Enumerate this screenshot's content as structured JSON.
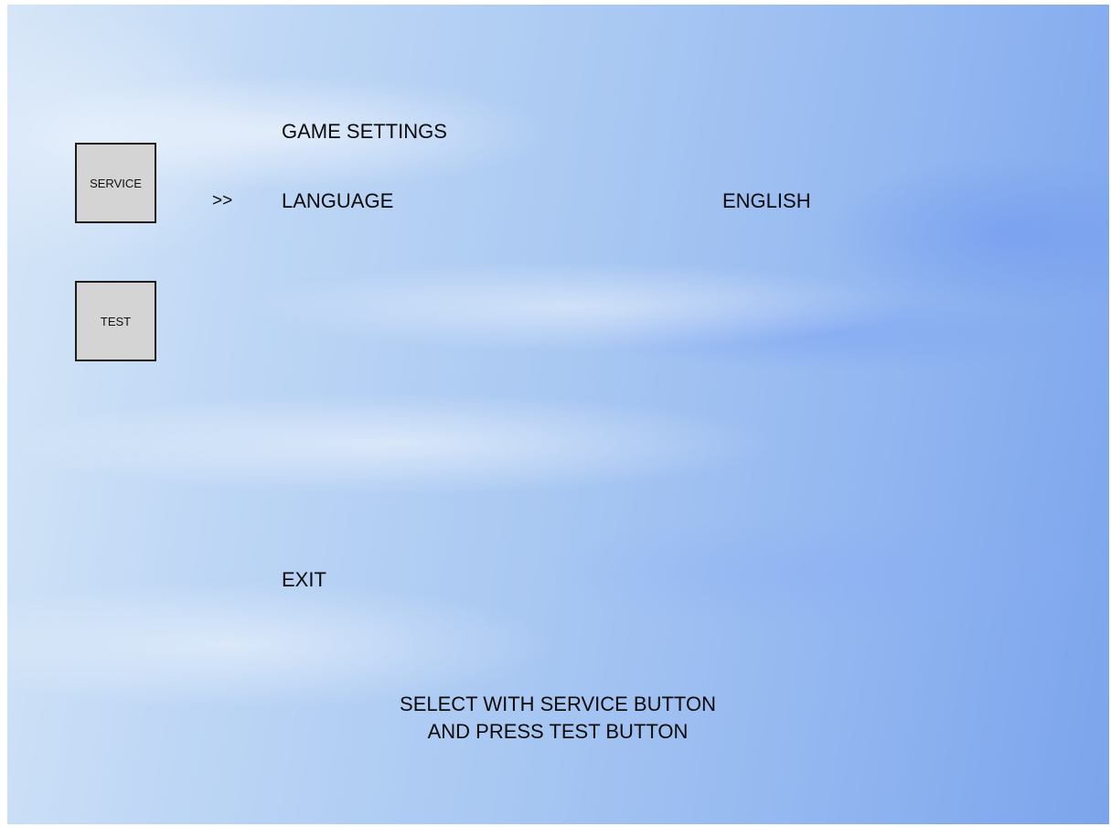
{
  "buttons": {
    "service_label": "SERVICE",
    "test_label": "TEST"
  },
  "menu": {
    "title": "GAME SETTINGS",
    "cursor": ">>",
    "options": [
      {
        "label": "LANGUAGE",
        "value": "ENGLISH"
      },
      {
        "label": "EXIT"
      }
    ]
  },
  "instructions": {
    "line1": "SELECT WITH SERVICE BUTTON",
    "line2": "AND PRESS TEST BUTTON"
  },
  "colors": {
    "button_face": "#d4d4d4",
    "text": "#0a0a0a",
    "background_light": "#d6e6f7",
    "background_dark": "#7ba4ec"
  }
}
